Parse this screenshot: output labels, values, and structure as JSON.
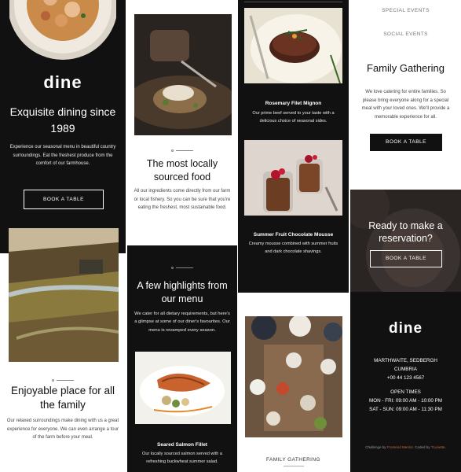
{
  "col1": {
    "logo": "dine",
    "hero_title": "Exquisite dining since 1989",
    "hero_text": "Experience our seasonal menu in beautiful country surroundings. Eat the freshest produce from the comfort of our farmhouse.",
    "book_label": "BOOK A TABLE",
    "family_title": "Enjoyable place for all the family",
    "family_text": "Our relaxed surroundings make dining with us a great experience for everyone. We can even arrange a tour of the farm before your meal."
  },
  "col2": {
    "local_title": "The most locally sourced food",
    "local_text": "All our ingredients come directly from our farm or local fishery. So you can be sure that you're eating the freshest, most sustainable food.",
    "highlights_title": "A few highlights from our menu",
    "highlights_text": "We cater for all dietary requirements, but here's a glimpse at some of our diner's favourites. Our menu is revamped every season.",
    "salmon_title": "Seared Salmon Fillet",
    "salmon_text": "Our locally sourced salmon served with a refreshing buckwheat summer salad."
  },
  "col3": {
    "filet_title": "Rosemary Filet Mignon",
    "filet_text": "Our prime beef served to your taste with a delicious choice of seasonal sides.",
    "mousse_title": "Summer Fruit Chocolate Mousse",
    "mousse_text": "Creamy mousse combined with summer fruits and dark chocolate shavings.",
    "family_tab": "FAMILY GATHERING"
  },
  "col4": {
    "tab_special": "SPECIAL EVENTS",
    "tab_social": "SOCIAL EVENTS",
    "gathering_title": "Family Gathering",
    "gathering_text": "We love catering for entire families. So please bring everyone along for a special meal with your loved ones. We'll provide a memorable experience for all.",
    "book_label": "BOOK A TABLE",
    "reserve_title": "Ready to make a reservation?",
    "reserve_book": "BOOK A TABLE",
    "footer_logo": "dine",
    "address_1": "MARTHWAITE, SEDBERGH",
    "address_2": "CUMBRIA",
    "phone": "+00 44 123 4567",
    "hours_title": "OPEN TIMES",
    "hours_1": "MON - FRI: 09:00 AM - 10:00 PM",
    "hours_2": "SAT - SUN: 09:00 AM - 11:30 PM",
    "credit_1": "Challenge by",
    "credit_link_1": "Frontend Mentor",
    "credit_2": ". Coded by",
    "credit_link_2": "TLunette",
    "credit_3": "."
  }
}
